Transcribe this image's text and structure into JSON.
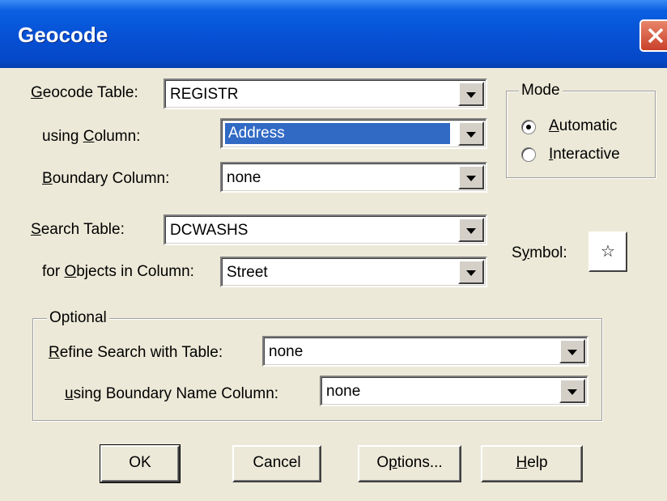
{
  "window": {
    "title": "Geocode"
  },
  "geocode_table": {
    "label_pre": "",
    "label_ul": "G",
    "label_post": "eocode Table:",
    "value": "REGISTR"
  },
  "using_column": {
    "label_pre": "using ",
    "label_ul": "C",
    "label_post": "olumn:",
    "value": "Address"
  },
  "boundary_column": {
    "label_pre": "",
    "label_ul": "B",
    "label_post": "oundary Column:",
    "value": "none"
  },
  "search_table": {
    "label_pre": "",
    "label_ul": "S",
    "label_post": "earch Table:",
    "value": "DCWASHS"
  },
  "objects_column": {
    "label_pre": "for ",
    "label_ul": "O",
    "label_post": "bjects in Column:",
    "value": "Street"
  },
  "mode": {
    "title": "Mode",
    "options": [
      {
        "ul": "A",
        "rest": "utomatic",
        "checked": true
      },
      {
        "ul": "I",
        "rest": "nteractive",
        "checked": false
      }
    ]
  },
  "symbol": {
    "label_pre": "S",
    "label_ul": "y",
    "label_post": "mbol:",
    "glyph": "☆"
  },
  "optional": {
    "title": "Optional",
    "refine": {
      "label_ul": "R",
      "label_post": "efine Search with Table:",
      "value": "none"
    },
    "boundary_name": {
      "label_ul": "u",
      "label_post": "sing Boundary Name Column:",
      "value": "none"
    }
  },
  "buttons": {
    "ok": "OK",
    "cancel": "Cancel",
    "options_pre": "O",
    "options_ul": "p",
    "options_post": "tions...",
    "help_ul": "H",
    "help_post": "elp"
  }
}
